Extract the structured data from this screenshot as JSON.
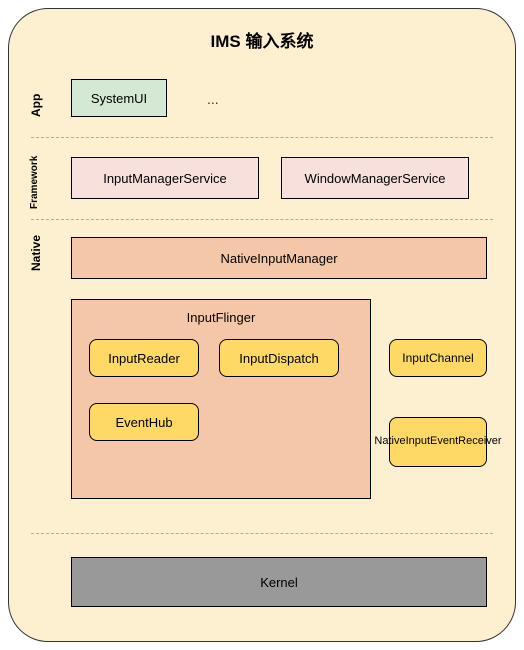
{
  "title": "IMS 输入系统",
  "layers": {
    "app": {
      "label": "App"
    },
    "framework": {
      "label": "Framework"
    },
    "native": {
      "label": "Native"
    }
  },
  "nodes": {
    "systemui": "SystemUI",
    "ellipsis": "...",
    "ims": "InputManagerService",
    "wms": "WindowManagerService",
    "nim": "NativeInputManager",
    "inputflinger": "InputFlinger",
    "inputreader": "InputReader",
    "inputdispatch": "InputDispatch",
    "eventhub": "EventHub",
    "inputchannel": "InputChannel",
    "nier": "NativeInputEventReceiver",
    "kernel": "Kernel"
  }
}
